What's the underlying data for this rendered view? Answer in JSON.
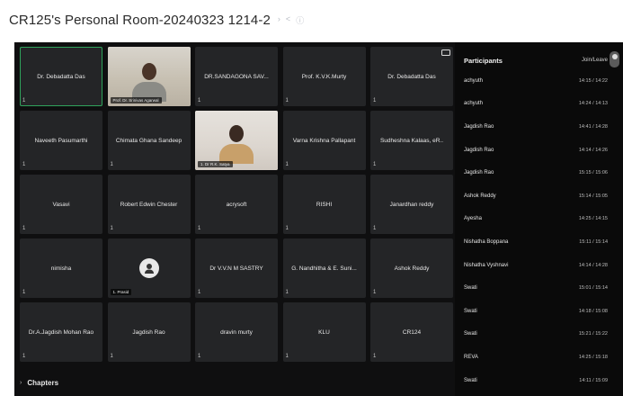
{
  "window": {
    "title": "CR125's Personal Room-20240323 1214-2",
    "title_icons": [
      "chevron-icon",
      "share-icon",
      "info-icon"
    ]
  },
  "grid": {
    "tiles": [
      {
        "name": "Dr. Debadatta Das",
        "active": true,
        "mic": "1"
      },
      {
        "name": "",
        "video": 1,
        "caption": "Prof. Dr. Srinivas Agarwal",
        "mic": ""
      },
      {
        "name": "DR.SANDAGONA SAV...",
        "mic": "1"
      },
      {
        "name": "Prof. K.V.K.Murty",
        "mic": "1"
      },
      {
        "name": "Dr. Debadatta Das",
        "mic": "1",
        "cam": true
      },
      {
        "name": "Naveeth Pasumarthi",
        "mic": "1"
      },
      {
        "name": "Chimata Ghana Sandeep",
        "mic": "1"
      },
      {
        "name": "",
        "video": 2,
        "caption": "1. Dr R.K. Satya",
        "mic": ""
      },
      {
        "name": "Varna Krishna Pallapant",
        "mic": "1"
      },
      {
        "name": "Sudheshna Kalaas, eR..",
        "mic": "1"
      },
      {
        "name": "Vasavi",
        "mic": "1"
      },
      {
        "name": "Robert Edwin Chester",
        "mic": "1"
      },
      {
        "name": "acrysoft",
        "mic": "1"
      },
      {
        "name": "RISHI",
        "mic": "1"
      },
      {
        "name": "Janardhan reddy",
        "mic": "1"
      },
      {
        "name": "nimisha",
        "mic": "1"
      },
      {
        "name": "",
        "avatar": true,
        "caption": "1. Prasid",
        "mic": ""
      },
      {
        "name": "Dr V.V.N M SASTRY",
        "mic": "1"
      },
      {
        "name": "G. Nandhitha & E. Suni...",
        "mic": "1"
      },
      {
        "name": "Ashok Reddy",
        "mic": "1"
      },
      {
        "name": "Dr.A.Jagdish Mohan Rao",
        "mic": "1"
      },
      {
        "name": "Jagdish Rao",
        "mic": "1"
      },
      {
        "name": "dravin murty",
        "mic": "1"
      },
      {
        "name": "KLU",
        "mic": "1"
      },
      {
        "name": "CR124",
        "mic": "1"
      }
    ]
  },
  "chapters": {
    "label": "Chapters"
  },
  "participants_panel": {
    "title": "Participants",
    "right_label": "Join/Leave",
    "rows": [
      {
        "name": "achyuth",
        "time": "14:15 / 14:22"
      },
      {
        "name": "achyuth",
        "time": "14:24 / 14:13"
      },
      {
        "name": "Jagdish Rao",
        "time": "14:41 / 14:28"
      },
      {
        "name": "Jagdish Rao",
        "time": "14:14 / 14:26"
      },
      {
        "name": "Jagdish Rao",
        "time": "15:15 / 15:06"
      },
      {
        "name": "Ashok Reddy",
        "time": "15:14 / 15:05"
      },
      {
        "name": "Ayesha",
        "time": "14:25 / 14:15"
      },
      {
        "name": "Nishatha Boppana",
        "time": "15:11 / 15:14"
      },
      {
        "name": "Nishatha Vyshnavi",
        "time": "14:14 / 14:28"
      },
      {
        "name": "Swati",
        "time": "15:01 / 15:14"
      },
      {
        "name": "Swati",
        "time": "14:18 / 15:08"
      },
      {
        "name": "Swati",
        "time": "15:21 / 15:22"
      },
      {
        "name": "REVA",
        "time": "14:25 / 15:18"
      },
      {
        "name": "Swati",
        "time": "14:11 / 15:09"
      }
    ]
  }
}
